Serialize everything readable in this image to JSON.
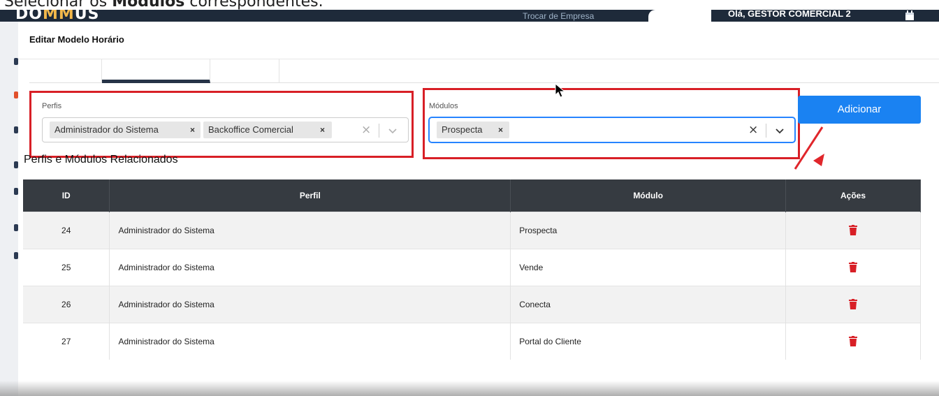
{
  "caption": {
    "prefix": "Selecionar os ",
    "bold": "Módulos",
    "suffix": " correspondentes."
  },
  "app_header": {
    "logo_start": "DO",
    "logo_highlight": "MM",
    "logo_end": "US",
    "switch_company": "Trocar de Empresa",
    "greeting": "Olá, GESTOR COMERCIAL 2"
  },
  "modal": {
    "title": "Editar Modelo Horário"
  },
  "perfis_field": {
    "label": "Perfis",
    "chips": [
      "Administrador do Sistema",
      "Backoffice Comercial"
    ]
  },
  "modulos_field": {
    "label": "Módulos",
    "chips": [
      "Prospecta"
    ]
  },
  "add_button": {
    "label": "Adicionar"
  },
  "section": {
    "title": "Perfis e Módulos Relacionados"
  },
  "table": {
    "headers": [
      "ID",
      "Perfil",
      "Módulo",
      "Ações"
    ],
    "rows": [
      {
        "id": "24",
        "perfil": "Administrador do Sistema",
        "modulo": "Prospecta"
      },
      {
        "id": "25",
        "perfil": "Administrador do Sistema",
        "modulo": "Vende"
      },
      {
        "id": "26",
        "perfil": "Administrador do Sistema",
        "modulo": "Conecta"
      },
      {
        "id": "27",
        "perfil": "Administrador do Sistema",
        "modulo": "Portal do Cliente"
      }
    ]
  },
  "colors": {
    "header_bg": "#363b41",
    "accent_blue": "#1a82f2",
    "highlight_red": "#d81f26",
    "delete_icon": "#d81f26"
  },
  "icons": {
    "chip_remove": "close-icon",
    "clear": "clear-icon",
    "dropdown": "chevron-down-icon",
    "delete": "trash-icon"
  }
}
